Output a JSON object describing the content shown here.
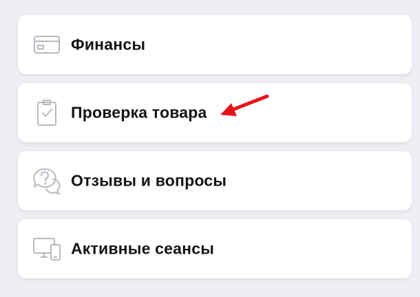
{
  "menu": {
    "items": [
      {
        "label": "Финансы",
        "icon": "credit-card-icon"
      },
      {
        "label": "Проверка товара",
        "icon": "clipboard-check-icon"
      },
      {
        "label": "Отзывы и вопросы",
        "icon": "chat-question-icon"
      },
      {
        "label": "Активные сеансы",
        "icon": "devices-icon"
      }
    ]
  },
  "colors": {
    "background": "#efeef4",
    "card": "#ffffff",
    "icon": "#b8b8c0",
    "text": "#141414",
    "annotation_arrow": "#e8141b"
  }
}
